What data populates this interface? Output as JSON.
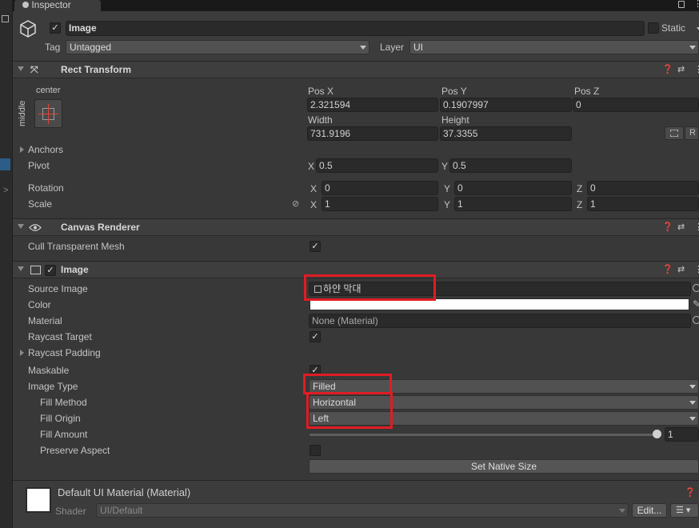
{
  "tab": {
    "title": "Inspector"
  },
  "object": {
    "active": true,
    "name": "Image",
    "static_label": "Static",
    "tag_label": "Tag",
    "tag_value": "Untagged",
    "layer_label": "Layer",
    "layer_value": "UI"
  },
  "rect_transform": {
    "title": "Rect Transform",
    "anchor_h": "center",
    "anchor_v": "middle",
    "pos_x_label": "Pos X",
    "pos_y_label": "Pos Y",
    "pos_z_label": "Pos Z",
    "pos_x": "2.321594",
    "pos_y": "0.1907997",
    "pos_z": "0",
    "width_label": "Width",
    "height_label": "Height",
    "width": "731.9196",
    "height": "37.3355",
    "r_button": "R",
    "anchors_label": "Anchors",
    "pivot_label": "Pivot",
    "pivot_x": "0.5",
    "pivot_y": "0.5",
    "rotation_label": "Rotation",
    "rot_x": "0",
    "rot_y": "0",
    "rot_z": "0",
    "scale_label": "Scale",
    "scale_x": "1",
    "scale_y": "1",
    "scale_z": "1",
    "x": "X",
    "y": "Y",
    "z": "Z"
  },
  "canvas_renderer": {
    "title": "Canvas Renderer",
    "cull_label": "Cull Transparent Mesh",
    "cull_checked": true
  },
  "image": {
    "title": "Image",
    "enabled": true,
    "source_image_label": "Source Image",
    "source_image_value": "하얀 막대",
    "color_label": "Color",
    "color_value": "#ffffff",
    "material_label": "Material",
    "material_value": "None (Material)",
    "raycast_target_label": "Raycast Target",
    "raycast_target_checked": true,
    "raycast_padding_label": "Raycast Padding",
    "maskable_label": "Maskable",
    "maskable_checked": true,
    "image_type_label": "Image Type",
    "image_type_value": "Filled",
    "fill_method_label": "Fill Method",
    "fill_method_value": "Horizontal",
    "fill_origin_label": "Fill Origin",
    "fill_origin_value": "Left",
    "fill_amount_label": "Fill Amount",
    "fill_amount_value": "1",
    "preserve_aspect_label": "Preserve Aspect",
    "preserve_aspect_checked": false,
    "set_native_size": "Set Native Size"
  },
  "material_footer": {
    "title": "Default UI Material (Material)",
    "shader_label": "Shader",
    "shader_value": "UI/Default",
    "edit_button": "Edit..."
  },
  "colors": {
    "highlight": "#e01c24",
    "panel": "#383838",
    "header": "#3e3e3e"
  }
}
